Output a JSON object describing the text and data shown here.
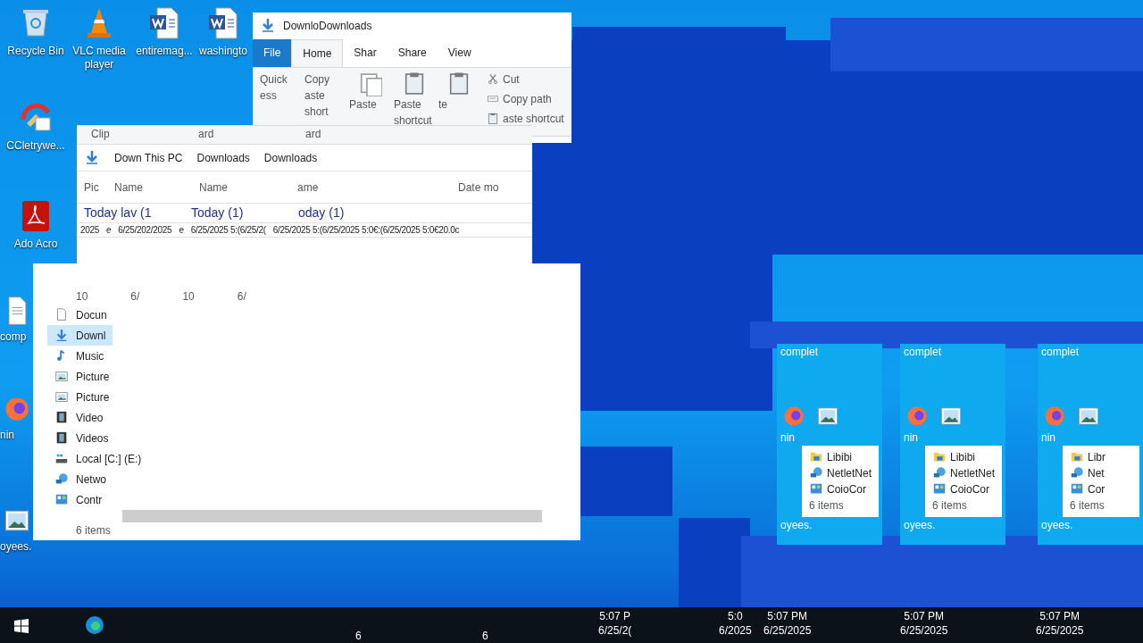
{
  "desktop_icons": [
    {
      "label": "Recycle Bin",
      "kind": "recycle"
    },
    {
      "label": "VLC media player",
      "kind": "vlc"
    },
    {
      "label": "entiremag...",
      "kind": "word"
    },
    {
      "label": "washingto",
      "kind": "word"
    },
    {
      "label": "CCletrywe...",
      "kind": "ccleaner"
    },
    {
      "label": "Ado Acro",
      "kind": "acrobat"
    },
    {
      "label": "comp",
      "kind": "doc"
    },
    {
      "label": "nin",
      "kind": "firefox"
    },
    {
      "label": "oyees.",
      "kind": "image"
    }
  ],
  "explorer": {
    "title": "DownloDownloads",
    "tabs": [
      {
        "label": "File",
        "kind": "file",
        "selected": false
      },
      {
        "label": "Home",
        "kind": "tab",
        "selected": true
      },
      {
        "label": "Shar",
        "kind": "tab",
        "selected": false
      },
      {
        "label": "Share",
        "kind": "tab",
        "selected": false
      },
      {
        "label": "View",
        "kind": "tab",
        "selected": false
      }
    ],
    "ribbon": [
      {
        "label": "Quick ess",
        "kind": "text"
      },
      {
        "label": "Copy aste short",
        "kind": "text"
      },
      {
        "label": "Paste",
        "kind": "copy"
      },
      {
        "label": "Paste shortcut",
        "kind": "paste"
      },
      {
        "label": "te",
        "kind": "clipboard"
      }
    ],
    "ribbon_small": [
      {
        "label": "Cut",
        "kind": "cut"
      },
      {
        "label": "Copy path",
        "kind": "path"
      },
      {
        "label": "aste shortcut",
        "kind": "paste"
      }
    ],
    "group_labels": [
      "Clip",
      "ard",
      "ard"
    ],
    "address": [
      "Down This PC",
      "Downloads",
      "Downloads"
    ],
    "columns": [
      "Pic",
      "Name",
      "Name",
      "ame",
      "Date mo"
    ],
    "groups": [
      "Today lav (1",
      "Today (1)",
      "oday (1)"
    ],
    "row": [
      "2025",
      "e",
      "6/25/202/2025",
      "e",
      "6/25/2025 5:(6/25/2(",
      "6/25/2025 5:(6/25/2025 5:0€:(6/25/2025 5:0€20.0c"
    ],
    "nav_items": [
      {
        "label": "Docun",
        "kind": "doc",
        "selected": false
      },
      {
        "label": "Downl",
        "kind": "download",
        "selected": true
      },
      {
        "label": "Music",
        "kind": "music",
        "selected": false
      },
      {
        "label": "Picture",
        "kind": "picture",
        "selected": false
      },
      {
        "label": "Picture",
        "kind": "picture",
        "selected": false
      },
      {
        "label": "Video",
        "kind": "video",
        "selected": false
      },
      {
        "label": "Videos",
        "kind": "video",
        "selected": false
      },
      {
        "label": "Local [C:] (E:)",
        "kind": "drive",
        "selected": false
      },
      {
        "label": "Netwo",
        "kind": "network",
        "selected": false
      },
      {
        "label": "Contr",
        "kind": "control",
        "selected": false
      }
    ],
    "stray_dates": [
      "10",
      "6/",
      "10",
      "6/"
    ],
    "status": "6 items"
  },
  "fragments": [
    {
      "top": "complet",
      "middle": "nin",
      "items": [
        {
          "label": "Libibi",
          "kind": "library"
        },
        {
          "label": "NetletNet",
          "kind": "network"
        },
        {
          "label": "CoioCor",
          "kind": "control"
        }
      ],
      "status": "6 items",
      "bottom": "oyees."
    },
    {
      "top": "complet",
      "middle": "nin",
      "items": [
        {
          "label": "Libibi",
          "kind": "library"
        },
        {
          "label": "NetletNet",
          "kind": "network"
        },
        {
          "label": "CoioCor",
          "kind": "control"
        }
      ],
      "status": "6 items",
      "bottom": "oyees."
    },
    {
      "top": "complet",
      "middle": "nin",
      "items": [
        {
          "label": "Libr",
          "kind": "library"
        },
        {
          "label": "Net",
          "kind": "network"
        },
        {
          "label": "Cor",
          "kind": "control"
        }
      ],
      "status": "6 items",
      "bottom": "oyees."
    }
  ],
  "taskbar": {
    "stray": [
      "6",
      "6"
    ],
    "clocks": [
      {
        "time": "5:07 P",
        "date": "6/25/2("
      },
      {
        "time": "5:0",
        "date": "6/2025"
      },
      {
        "time": "5:07 PM",
        "date": "6/25/2025"
      },
      {
        "time": "5:07 PM",
        "date": "6/25/2025"
      },
      {
        "time": "5:07 PM",
        "date": "6/25/2025"
      }
    ]
  }
}
